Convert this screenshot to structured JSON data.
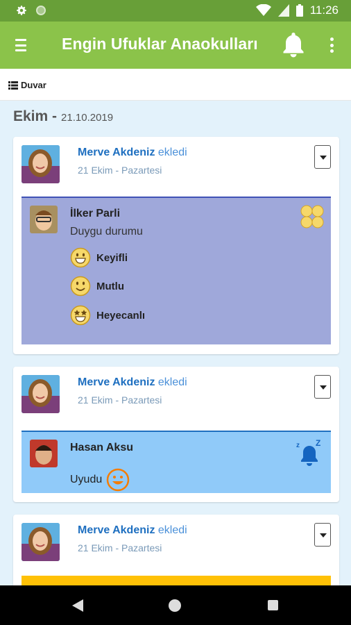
{
  "status_bar": {
    "time": "11:26"
  },
  "app_bar": {
    "title": "Engin Ufuklar Anaokulları"
  },
  "sub_bar": {
    "wall_label": "Duvar"
  },
  "section": {
    "month": "Ekim -",
    "date": "21.10.2019"
  },
  "cards": [
    {
      "author": "Merve Akdeniz",
      "verb": "ekledi",
      "time": "21 Ekim - Pazartesi",
      "child": "İlker Parli",
      "mood_title": "Duygu durumu",
      "moods": [
        "Keyifli",
        "Mutlu",
        "Heyecanlı"
      ],
      "panel_color": "#9fa8da"
    },
    {
      "author": "Merve Akdeniz",
      "verb": "ekledi",
      "time": "21 Ekim - Pazartesi",
      "child": "Hasan Aksu",
      "status": "Uyudu",
      "panel_color": "#90caf9"
    },
    {
      "author": "Merve Akdeniz",
      "verb": "ekledi",
      "time": "21 Ekim - Pazartesi",
      "panel_color": "#ffc107"
    }
  ],
  "colors": {
    "status_bar": "#689f38",
    "app_bar": "#8bc34a",
    "background": "#e3f2fb",
    "author_link": "#1e6fc0"
  }
}
